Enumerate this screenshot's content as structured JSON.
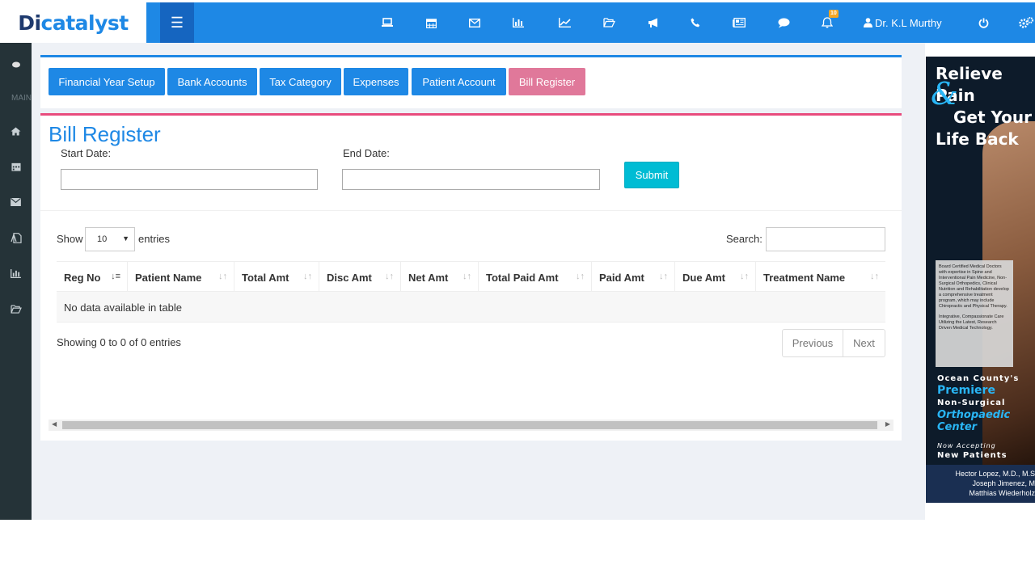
{
  "brand": {
    "logo_dark": "Di",
    "logo_accent": "catalyst"
  },
  "topbar": {
    "icons": [
      "laptop-icon",
      "calendar-icon",
      "envelope-icon",
      "bar-chart-icon",
      "line-chart-icon",
      "folder-open-icon",
      "bullhorn-icon",
      "phone-icon",
      "newspaper-icon",
      "comment-icon",
      "bell-icon"
    ],
    "notification_count": "10",
    "user_name": "Dr. K.L Murthy",
    "icon_power": "power-icon",
    "icon_settings": "gears-icon"
  },
  "sidebar": {
    "section_label": "MAIN",
    "icons": [
      "home-icon",
      "calendar-icon",
      "envelope-icon",
      "pdf-file-icon",
      "bar-chart-icon",
      "folder-open-icon"
    ]
  },
  "tabs": [
    {
      "label": "Financial Year Setup",
      "active": false
    },
    {
      "label": "Bank Accounts",
      "active": false
    },
    {
      "label": "Tax Category",
      "active": false
    },
    {
      "label": "Expenses",
      "active": false
    },
    {
      "label": "Patient Account",
      "active": false
    },
    {
      "label": "Bill Register",
      "active": true
    }
  ],
  "form": {
    "title": "Bill Register",
    "start_label": "Start Date:",
    "start_value": "",
    "end_label": "End Date:",
    "end_value": "",
    "submit_label": "Submit"
  },
  "table": {
    "show_label": "Show",
    "entries_value": "10",
    "entries_label": "entries",
    "search_label": "Search:",
    "search_value": "",
    "columns": [
      "Reg No",
      "Patient Name",
      "Total Amt",
      "Disc Amt",
      "Net Amt",
      "Total Paid Amt",
      "Paid Amt",
      "Due Amt",
      "Treatment Name"
    ],
    "empty_message": "No data available in table",
    "info": "Showing 0 to 0 of 0 entries",
    "prev_label": "Previous",
    "next_label": "Next"
  },
  "ad": {
    "headline1": "Relieve Pain",
    "headline_amp": "&",
    "headline2": "Get Your",
    "headline3": "Life Back",
    "bullet1": "Board Certified Medical Doctors with expertise in Spine and Interventional Pain Medicine, Non-Surgical Orthopedics, Clinical Nutrition and Rehabilitation develop a comprehensive treatment program, which may include Chiropractic and Physical Therapy.",
    "bullet2": "Integrative, Compassionate Care Utilizing the Latest, Research Driven Medical Technology.",
    "line1": "Ocean County's",
    "line2": "Premiere",
    "line3": "Non-Surgical",
    "line4": "Orthopaedic",
    "line5": "Center",
    "line6": "Now Accepting",
    "line7": "New Patients",
    "doc1": "Hector Lopez, M.D., M.S",
    "doc2": "Joseph Jimenez, M",
    "doc3": "Matthias Wiederholz"
  }
}
